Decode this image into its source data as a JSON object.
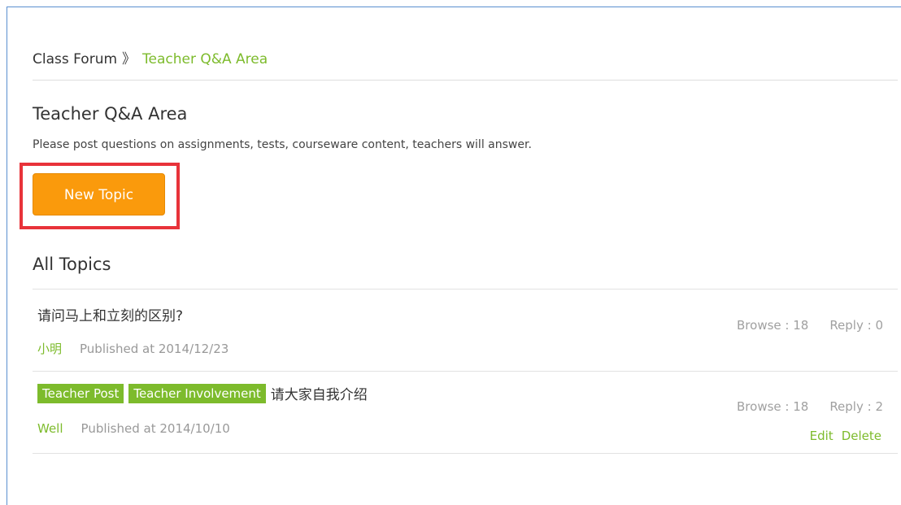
{
  "breadcrumb": {
    "root": "Class Forum",
    "separator": "》",
    "current": "Teacher Q&A Area"
  },
  "area": {
    "title": "Teacher Q&A Area",
    "description": "Please post questions on assignments, tests, courseware content, teachers will answer."
  },
  "new_topic_label": "New Topic",
  "section_title": "All Topics",
  "topics": [
    {
      "title": "请问马上和立刻的区别?",
      "tags": [],
      "author": "小明",
      "published": "Published at 2014/12/23",
      "browse": "Browse : 18",
      "reply": "Reply : 0"
    },
    {
      "title": "请大家自我介绍",
      "tags": [
        "Teacher Post",
        "Teacher Involvement"
      ],
      "author": "Well",
      "published": "Published at 2014/10/10",
      "browse": "Browse : 18",
      "reply": "Reply : 2",
      "actions": {
        "edit": "Edit",
        "delete": "Delete"
      }
    }
  ],
  "colors": {
    "accent_green": "#7dbb2c",
    "button_orange": "#fa9a0c",
    "highlight_red": "#e8333a",
    "frame_blue": "#5b8fd0"
  }
}
